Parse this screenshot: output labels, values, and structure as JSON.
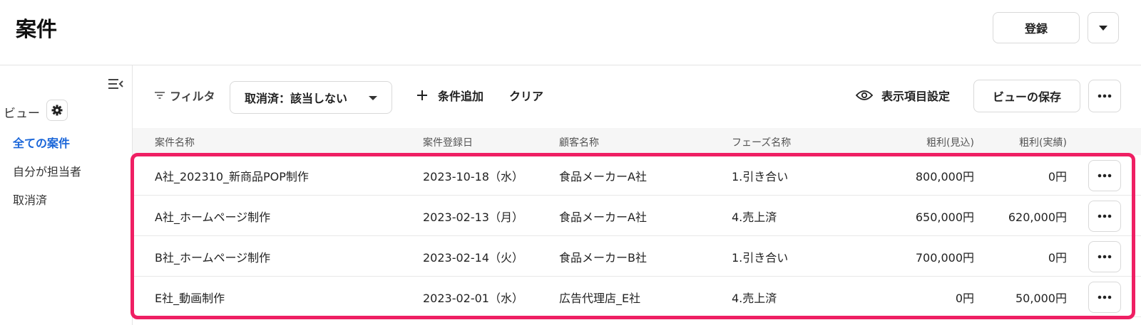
{
  "header": {
    "title": "案件",
    "register_label": "登録",
    "dropdown_icon": "chevron-down-icon"
  },
  "sidebar": {
    "collapse_icon": "collapse-sidebar-icon",
    "view_label": "ビュー",
    "gear_icon": "gear-icon",
    "items": [
      {
        "label": "全ての案件",
        "active": true
      },
      {
        "label": "自分が担当者",
        "active": false
      },
      {
        "label": "取消済",
        "active": false
      }
    ]
  },
  "filterbar": {
    "filter_label": "フィルタ",
    "filter_chip": "取消済：該当しない",
    "add_condition": "条件追加",
    "clear": "クリア",
    "column_settings": "表示項目設定",
    "save_view": "ビューの保存"
  },
  "table": {
    "columns": [
      "案件名称",
      "案件登録日",
      "顧客名称",
      "フェーズ名称",
      "粗利(見込)",
      "粗利(実績)"
    ],
    "rows": [
      [
        "A社_202310_新商品POP制作",
        "2023-10-18（水）",
        "食品メーカーA社",
        "1.引き合い",
        "800,000円",
        "0円"
      ],
      [
        "A社_ホームページ制作",
        "2023-02-13（月）",
        "食品メーカーA社",
        "4.売上済",
        "650,000円",
        "620,000円"
      ],
      [
        "B社_ホームページ制作",
        "2023-02-14（火）",
        "食品メーカーB社",
        "1.引き合い",
        "700,000円",
        "0円"
      ],
      [
        "E社_動画制作",
        "2023-02-01（水）",
        "広告代理店_E社",
        "4.売上済",
        "0円",
        "50,000円"
      ]
    ]
  },
  "colors": {
    "accent": "#1a66d9",
    "highlight": "#ef1f63"
  }
}
